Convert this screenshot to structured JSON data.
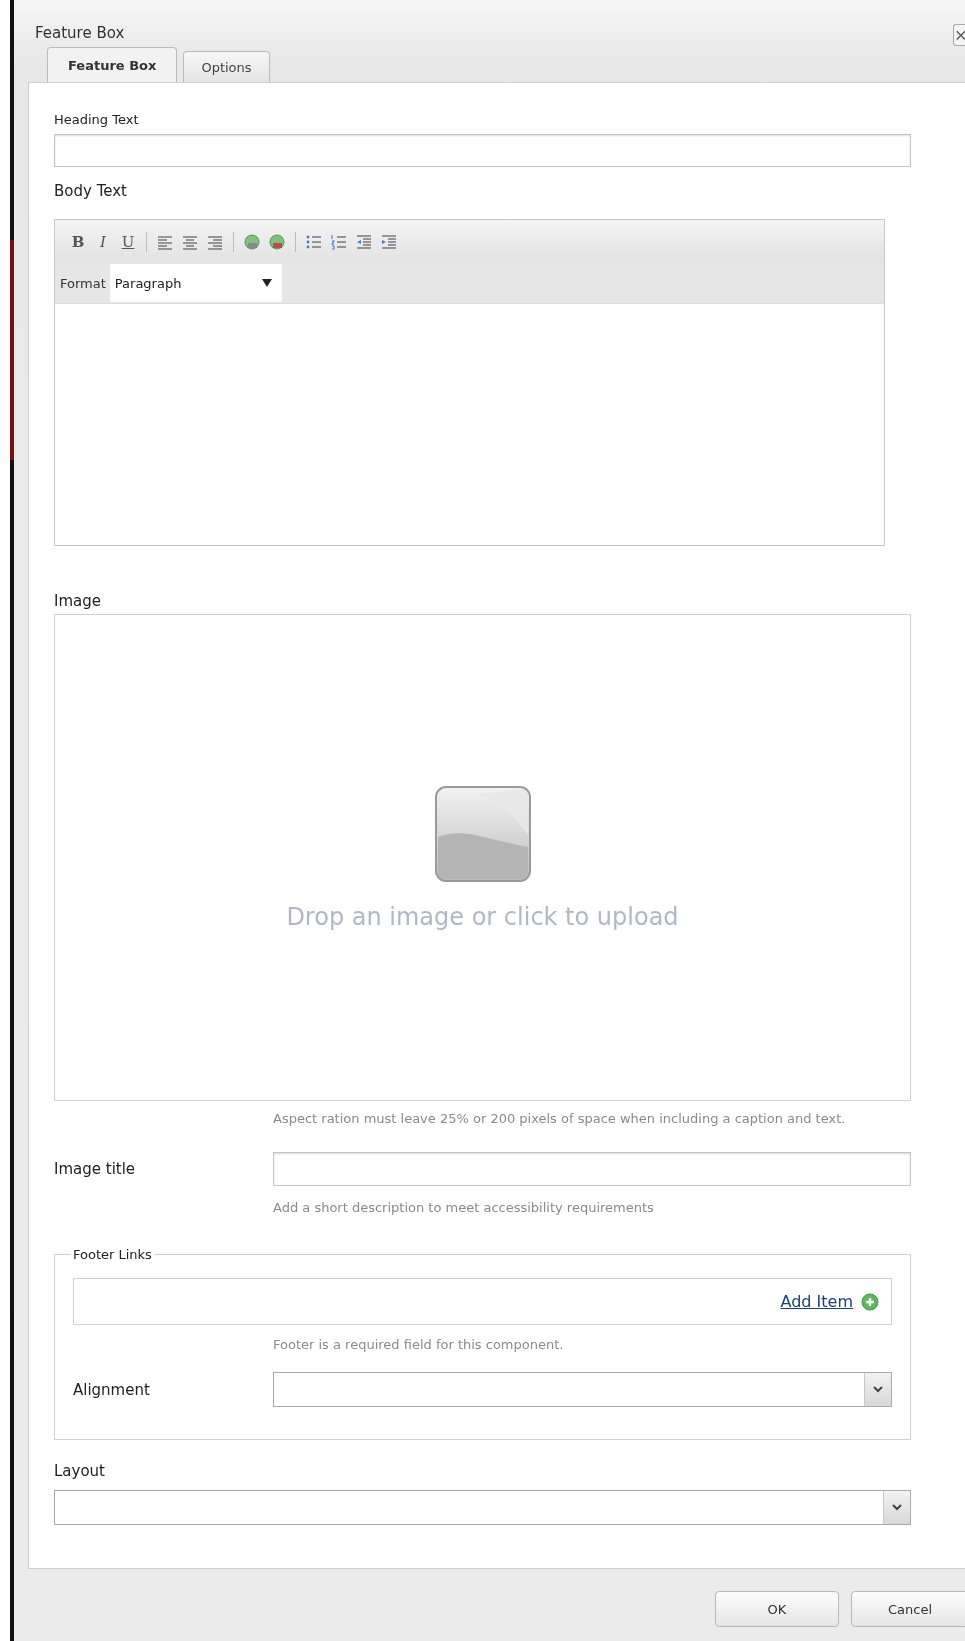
{
  "window": {
    "title": "Feature Box"
  },
  "tabs": [
    {
      "label": "Feature Box",
      "selected": true
    },
    {
      "label": "Options",
      "selected": false
    }
  ],
  "heading_text": {
    "label": "Heading Text"
  },
  "body_text": {
    "label": "Body Text",
    "toolbar": [
      {
        "kind": "bold",
        "label": "B"
      },
      {
        "kind": "italic",
        "label": "I"
      },
      {
        "kind": "underline",
        "label": "U"
      },
      {
        "kind": "separator"
      },
      {
        "kind": "align-left"
      },
      {
        "kind": "align-center"
      },
      {
        "kind": "align-right"
      },
      {
        "kind": "separator"
      },
      {
        "kind": "link"
      },
      {
        "kind": "unlink"
      },
      {
        "kind": "separator"
      },
      {
        "kind": "bullets"
      },
      {
        "kind": "numbers"
      },
      {
        "kind": "outdent"
      },
      {
        "kind": "indent"
      }
    ],
    "format": {
      "label": "Format",
      "value": "Paragraph"
    }
  },
  "image": {
    "label": "Image",
    "drop_hint": "Drop an image or click to upload",
    "help": "Aspect ration must leave 25% or 200 pixels of space when including a caption and text."
  },
  "image_title": {
    "label": "Image title",
    "help": "Add a short description to meet accessibility requirements"
  },
  "footer_links": {
    "legend": "Footer Links",
    "add_item": "Add Item",
    "help": "Footer is a required field for this component.",
    "alignment": {
      "label": "Alignment"
    }
  },
  "layout": {
    "label": "Layout"
  },
  "buttons": [
    {
      "label": "OK"
    },
    {
      "label": "Cancel"
    }
  ]
}
